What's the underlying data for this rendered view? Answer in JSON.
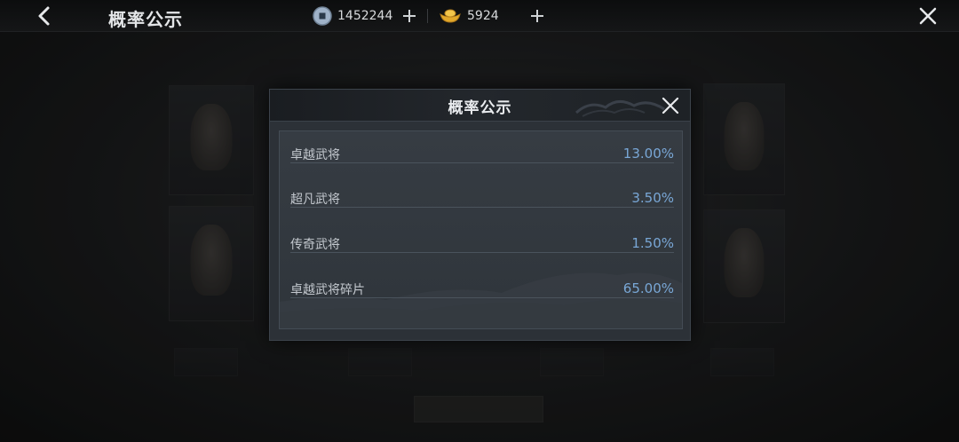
{
  "topbar": {
    "title": "概率公示",
    "currency_coin": {
      "icon": "coin-icon",
      "value": "1452244"
    },
    "currency_ingot": {
      "icon": "gold-ingot-icon",
      "value": "5924"
    }
  },
  "modal": {
    "title": "概率公示",
    "rows": [
      {
        "label": "卓越武将",
        "value": "13.00%"
      },
      {
        "label": "超凡武将",
        "value": "3.50%"
      },
      {
        "label": "传奇武将",
        "value": "1.50%"
      },
      {
        "label": "卓越武将碎片",
        "value": "65.00%"
      }
    ]
  },
  "colors": {
    "accent_value": "#79a7d6",
    "modal_bg": "#2c3137",
    "topbar_bg": "#0c0d0e"
  }
}
